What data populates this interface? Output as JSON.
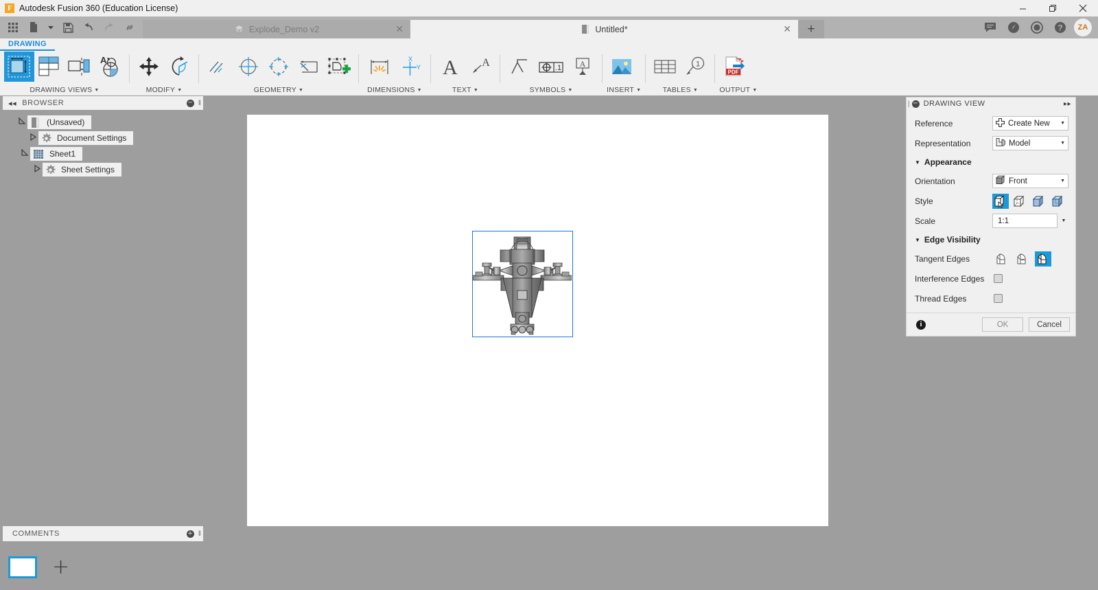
{
  "window": {
    "title": "Autodesk Fusion 360 (Education License)",
    "logo_letter": "F",
    "minimize": "─",
    "maximize": "❐",
    "close": "✕"
  },
  "quick_access": [
    {
      "name": "app-grid-icon",
      "label": "grid-icon"
    },
    {
      "name": "new-file-icon",
      "label": "file-icon"
    },
    {
      "name": "new-file-dropdown",
      "label": "▾"
    },
    {
      "name": "save-icon",
      "label": "save-icon"
    },
    {
      "name": "undo-icon",
      "label": "undo-icon"
    },
    {
      "name": "redo-icon",
      "label": "redo-icon"
    },
    {
      "name": "link-icon",
      "label": "link-icon"
    }
  ],
  "tabs": [
    {
      "label": "Explode_Demo v2",
      "active": false,
      "icon": "cube-icon",
      "close": "✕"
    },
    {
      "label": "Untitled*",
      "active": true,
      "icon": "drawing-icon",
      "close": "✕"
    }
  ],
  "tab_add": "+",
  "tab_right_icons": [
    {
      "name": "comment-icon"
    },
    {
      "name": "help-circle-icon"
    },
    {
      "name": "clock-icon"
    },
    {
      "name": "question-icon"
    }
  ],
  "account": {
    "initials": "ZA"
  },
  "ribbon": {
    "active_tab": "DRAWING",
    "panels": [
      {
        "label": "DRAWING VIEWS",
        "has_caret": true,
        "tools": [
          {
            "name": "base-view-tool",
            "selected": true
          },
          {
            "name": "projected-view-tool",
            "selected": false
          },
          {
            "name": "section-view-tool",
            "selected": false
          },
          {
            "name": "detail-view-tool",
            "selected": false
          }
        ]
      },
      {
        "label": "MODIFY",
        "has_caret": true,
        "tools": [
          {
            "name": "move-view-tool",
            "selected": false
          },
          {
            "name": "rotate-view-tool",
            "selected": false
          }
        ]
      },
      {
        "label": "GEOMETRY",
        "has_caret": true,
        "tools": [
          {
            "name": "centerline-tool",
            "selected": false
          },
          {
            "name": "center-mark-tool",
            "selected": false
          },
          {
            "name": "bolt-circle-center-mark-tool",
            "selected": false
          },
          {
            "name": "edge-extension-tool",
            "selected": false
          },
          {
            "name": "sketch-tool",
            "selected": false
          }
        ]
      },
      {
        "label": "DIMENSIONS",
        "has_caret": true,
        "tools": [
          {
            "name": "dimension-tool",
            "selected": false
          },
          {
            "name": "ordinate-dimension-tool",
            "selected": false
          }
        ]
      },
      {
        "label": "TEXT",
        "has_caret": true,
        "tools": [
          {
            "name": "text-tool",
            "selected": false
          },
          {
            "name": "leader-text-tool",
            "selected": false
          }
        ]
      },
      {
        "label": "SYMBOLS",
        "has_caret": true,
        "tools": [
          {
            "name": "surface-texture-tool",
            "selected": false
          },
          {
            "name": "feature-control-frame-tool",
            "selected": false
          },
          {
            "name": "datum-identifier-tool",
            "selected": false
          }
        ]
      },
      {
        "label": "INSERT",
        "has_caret": true,
        "tools": [
          {
            "name": "insert-image-tool",
            "selected": false
          }
        ]
      },
      {
        "label": "TABLES",
        "has_caret": true,
        "tools": [
          {
            "name": "table-tool",
            "selected": false
          },
          {
            "name": "balloon-tool",
            "selected": false,
            "badge": "1"
          }
        ]
      },
      {
        "label": "OUTPUT",
        "has_caret": true,
        "tools": [
          {
            "name": "export-pdf-tool",
            "selected": false,
            "badge": "PDF"
          }
        ]
      }
    ]
  },
  "browser": {
    "title": "BROWSER",
    "collapse_icon": "◂◂",
    "minimize_icon": "─",
    "grip": "‖",
    "tree": [
      {
        "label": "(Unsaved)",
        "depth": 0,
        "twist": "expanded",
        "icon": "drawing-icon"
      },
      {
        "label": "Document Settings",
        "depth": 1,
        "twist": "collapsed",
        "icon": "gear-icon"
      },
      {
        "label": "Sheet1",
        "depth": 1,
        "twist": "expanded",
        "icon": "sheet-icon"
      },
      {
        "label": "Sheet Settings",
        "depth": 2,
        "twist": "collapsed",
        "icon": "gear-icon"
      }
    ]
  },
  "comments": {
    "title": "COMMENTS",
    "add_icon": "+",
    "grip": "‖"
  },
  "navbar": [
    {
      "name": "pan-icon"
    },
    {
      "name": "zoom-window-icon"
    },
    {
      "name": "fit-icon"
    }
  ],
  "sheet_tabs": {
    "thumbnail_name": "sheet1-thumbnail",
    "add_label": "+"
  },
  "dialog": {
    "title": "DRAWING VIEW",
    "minimize_icon": "─",
    "expand_icon": "▸▸",
    "grip": "|",
    "rows": [
      {
        "label": "Reference",
        "value": "Create New",
        "icon": "create-new-icon",
        "type": "combo"
      },
      {
        "label": "Representation",
        "value": "Model",
        "icon": "model-icon",
        "type": "combo"
      }
    ],
    "appearance": {
      "title": "Appearance",
      "triangle": "▼",
      "orientation_label": "Orientation",
      "orientation_value": "Front",
      "orientation_icon": "cube-front-icon",
      "style_label": "Style",
      "styles": [
        {
          "name": "visible-edges-style",
          "selected": true
        },
        {
          "name": "visible-and-hidden-edges-style",
          "selected": false
        },
        {
          "name": "shaded-style",
          "selected": false
        },
        {
          "name": "shaded-with-hidden-edges-style",
          "selected": false
        }
      ],
      "scale_label": "Scale",
      "scale_value": "1:1"
    },
    "edge_visibility": {
      "title": "Edge Visibility",
      "triangle": "▼",
      "tangent_label": "Tangent Edges",
      "tangent_options": [
        {
          "name": "tangent-edges-off",
          "selected": false
        },
        {
          "name": "tangent-edges-shortened",
          "selected": false
        },
        {
          "name": "tangent-edges-full",
          "selected": true
        }
      ],
      "interference_label": "Interference Edges",
      "interference_checked": false,
      "thread_label": "Thread Edges",
      "thread_checked": false
    },
    "footer": {
      "info_icon": "i",
      "ok_label": "OK",
      "cancel_label": "Cancel"
    }
  },
  "colors": {
    "accent_blue": "#1a9ad8",
    "ribbon_blue": "#2196d8",
    "tab_active_bg": "#f0f0f0",
    "app_bg": "#9e9e9e",
    "sheet_white": "#ffffff",
    "view_border": "#1a73e8",
    "logo_orange": "#f5a623"
  }
}
